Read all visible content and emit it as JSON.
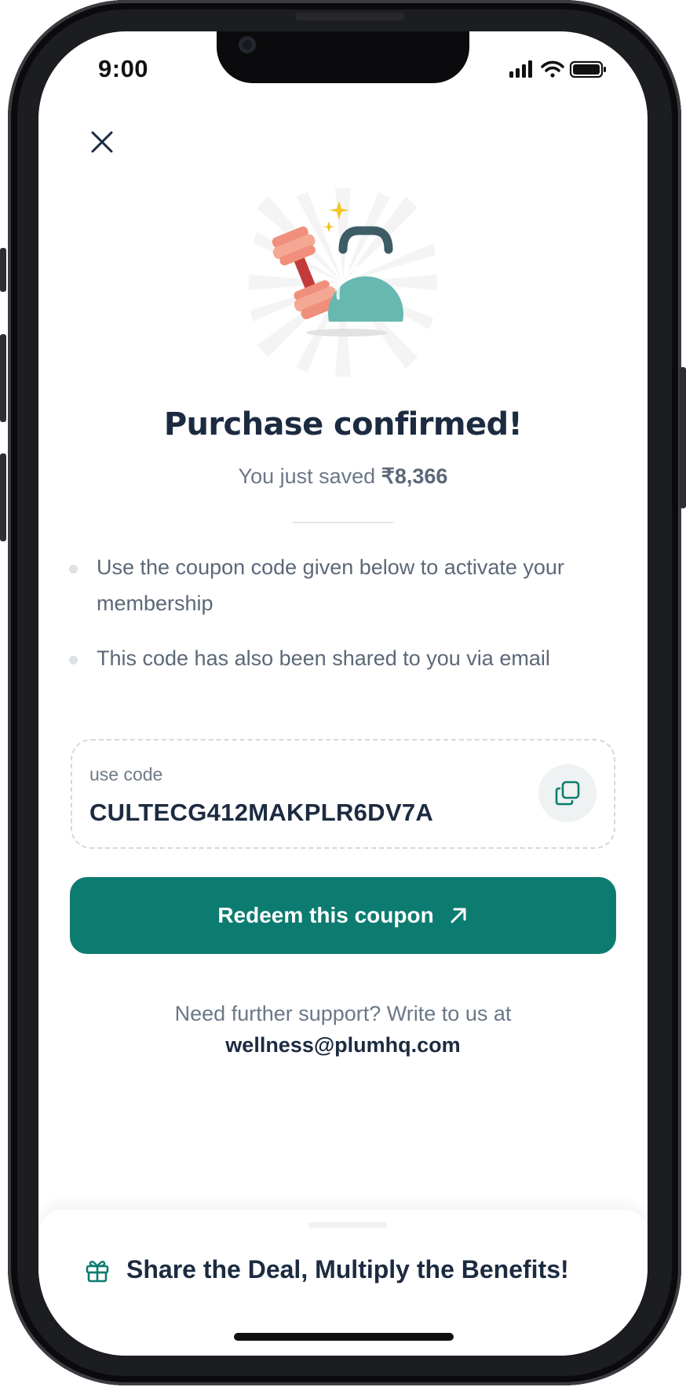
{
  "status_bar": {
    "time": "9:00"
  },
  "header": {
    "close_icon": "close-icon"
  },
  "illustration": {
    "icon": "dumbbell-kettlebell-icon"
  },
  "confirmation": {
    "title": "Purchase confirmed!",
    "saved_prefix": "You just saved",
    "saved_amount": "₹8,366"
  },
  "instructions": [
    {
      "text": "Use the coupon code given below to activate your membership"
    },
    {
      "text": "This code has also been shared to you via email"
    }
  ],
  "coupon": {
    "label": "use code",
    "code": "CULTECG412MAKPLR6DV7A",
    "copy_icon": "copy-icon"
  },
  "redeem_button": {
    "label": "Redeem this coupon",
    "icon": "arrow-up-right-icon"
  },
  "support": {
    "text": "Need further support? Write to us at",
    "email": "wellness@plumhq.com"
  },
  "share_sheet": {
    "label": "Share the Deal, Multiply the Benefits!",
    "icon": "gift-icon"
  },
  "colors": {
    "primary": "#0d7c70",
    "heading": "#1c2b40",
    "muted": "#6b7788"
  }
}
